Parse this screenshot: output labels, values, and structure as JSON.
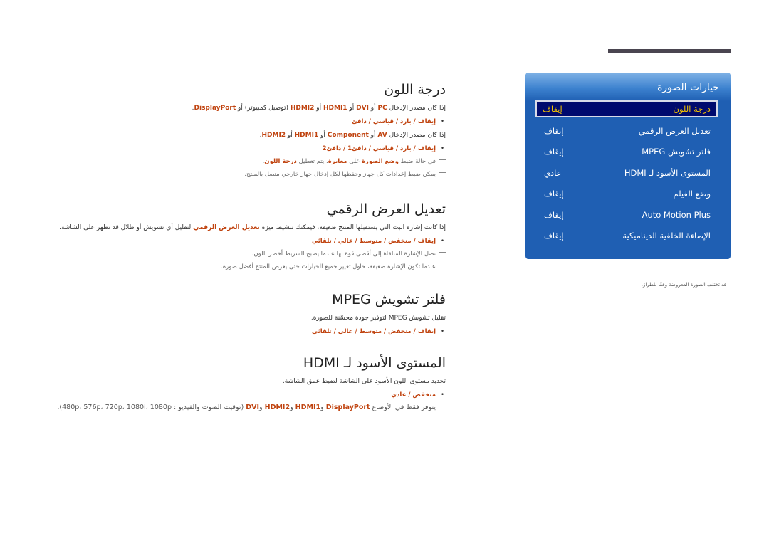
{
  "panel": {
    "title": "خيارات الصورة",
    "items": [
      {
        "label": "درجة اللون",
        "value": "إيقاف",
        "selected": true
      },
      {
        "label": "تعديل العرض الرقمي",
        "value": "إيقاف"
      },
      {
        "label": "فلتر تشويش MPEG",
        "value": "إيقاف"
      },
      {
        "label": "المستوى الأسود لـ HDMI",
        "value": "عادي"
      },
      {
        "label": "وضع الفيلم",
        "value": "إيقاف"
      },
      {
        "label": "Auto Motion Plus",
        "value": "إيقاف"
      },
      {
        "label": "الإضاءة الخلفية الديناميكية",
        "value": "إيقاف"
      }
    ],
    "note": "– قد تختلف الصورة المعروضة وفقًا للطراز."
  },
  "sections": {
    "color_tone": {
      "title": "درجة اللون",
      "p1_a": "إذا كان مصدر الإدخال ",
      "p1_pc": "PC",
      "p1_or": " أو ",
      "p1_dvi": "DVI",
      "p1_hdmi1": "HDMI1",
      "p1_hdmi2": "HDMI2",
      "p1_b": " (توصيل كمبيوتر) أو ",
      "p1_dp": "DisplayPort",
      "p1_end": ".",
      "bullet1": "إيقاف / بارد / قياسي / دافئ",
      "p2_a": "إذا كان مصدر الإدخال ",
      "p2_av": "AV",
      "p2_comp": "Component",
      "p2_hdmi1": "HDMI1",
      "p2_hdmi2": "HDMI2",
      "bullet2": "إيقاف / بارد / قياسي / دافئ1 / دافئ2",
      "note1_a": "في حالة ضبط ",
      "note1_b": "وضع الصورة",
      "note1_c": " على ",
      "note1_d": "معايرة",
      "note1_e": "، يتم تعطيل ",
      "note1_f": "درجة اللون",
      "note2": "يمكن ضبط إعدادات كل جهاز وحفظها لكل إدخال جهاز خارجي متصل بالمنتج."
    },
    "digital_clean": {
      "title": "تعديل العرض الرقمي",
      "p1_a": "إذا كانت إشارة البث التي يستقبلها المنتج ضعيفة، فيمكنك تنشيط ميزة ",
      "p1_b": "تعديل العرض الرقمي",
      "p1_c": " لتقليل أي تشويش أو ظلال قد تظهر على الشاشة.",
      "bullet": "إيقاف / منخفض / متوسط / عالي / تلقائي",
      "note1": "تصل الإشارة المتلقاة إلى أقصى قوة لها عندما يصبح الشريط أخضر اللون.",
      "note2": "عندما تكون الإشارة ضعيفة، حاول تغيير جميع الخيارات حتى يعرض المنتج أفضل صورة."
    },
    "mpeg": {
      "title": "فلتر تشويش MPEG",
      "p1": "تقليل تشويش MPEG لتوفير جودة محسّنة للصورة.",
      "bullet": "إيقاف / منخفض / متوسط / عالي / تلقائي"
    },
    "hdmi_black": {
      "title": "المستوى الأسود لـ HDMI",
      "p1": "تحديد مستوى اللون الأسود على الشاشة لضبط عمق الشاشة.",
      "bullet": "منخفض / عادي",
      "note_a": "يتوفر فقط في الأوضاع ",
      "note_dp": "DisplayPort",
      "note_and": " و",
      "note_hdmi1": "HDMI1",
      "note_hdmi2": "HDMI2",
      "note_dvi": "DVI",
      "note_b": " (توقيت الصوت والفيديو : 480p، 576p، 720p، 1080i، 1080p)."
    }
  }
}
